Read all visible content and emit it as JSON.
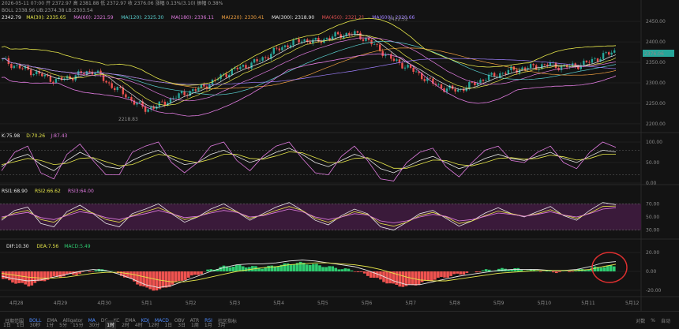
{
  "header": {
    "main_info": "2026-05-11 07:00  开 2372.97  高 2381.88  低 2372.97  收 2376.06  涨幅 0.13%(3.10)  振幅 0.38%",
    "boll": "BOLL  2338.96  UB:2374.38  LB:2303.54",
    "ma_line": [
      {
        "text": "2342.79",
        "color": "#e8e8e8"
      },
      {
        "text": "MA(30): 2335.65",
        "color": "#e6e64a"
      },
      {
        "text": "MA(60): 2321.59",
        "color": "#e07be0"
      },
      {
        "text": "MA(120): 2325.30",
        "color": "#5ad0d0"
      },
      {
        "text": "MA(180): 2336.11",
        "color": "#e07be0"
      },
      {
        "text": "MA(220): 2330.41",
        "color": "#f0a040"
      },
      {
        "text": "MA(300): 2318.90",
        "color": "#e8e8e8"
      },
      {
        "text": "MA(450): 2321.21",
        "color": "#e05050"
      },
      {
        "text": "MA(600): 2320.66",
        "color": "#a080ff"
      }
    ],
    "kdj": [
      {
        "text": "K:75.98",
        "color": "#e8e8e8"
      },
      {
        "text": "D:70.26",
        "color": "#e6e64a"
      },
      {
        "text": "J:87.43",
        "color": "#e07be0"
      }
    ],
    "rsi": [
      {
        "text": "RSI1:68.90",
        "color": "#e8e8e8"
      },
      {
        "text": "RSI2:66.62",
        "color": "#e6e64a"
      },
      {
        "text": "RSI3:64.00",
        "color": "#e07be0"
      }
    ],
    "macd": [
      {
        "text": "DIF:10.30",
        "color": "#e8e8e8"
      },
      {
        "text": "DEA:7.56",
        "color": "#e6e64a"
      },
      {
        "text": "MACD:5.49",
        "color": "#2ecc71"
      }
    ]
  },
  "price_axis": {
    "ticks": [
      "2450.00",
      "2400.00",
      "2350.00",
      "2300.00",
      "2250.00",
      "2200.00"
    ],
    "current": "2376.06",
    "high_label": "2422.52",
    "low_label": "2218.83"
  },
  "kdj_axis": {
    "ticks": [
      "100.00",
      "50.00",
      "0.00"
    ]
  },
  "rsi_axis": {
    "ticks": [
      "70.00",
      "50.00",
      "30.00"
    ]
  },
  "macd_axis": {
    "ticks": [
      "20.00",
      "0.00",
      "-20.00"
    ]
  },
  "x_axis": {
    "labels": [
      "4月28",
      "4月29",
      "4月30",
      "5月1",
      "5月2",
      "5月3",
      "5月4",
      "5月5",
      "5月6",
      "5月7",
      "5月8",
      "5月9",
      "5月10",
      "5月11",
      "5月12"
    ]
  },
  "toolbar": {
    "left": [
      "日期范围",
      "BOLL",
      "EMA",
      "Alligator",
      "MA",
      "DC",
      "KC",
      "",
      "EMA",
      "KDJ",
      "MACD",
      "OBV",
      "ATR",
      "RSI",
      "社区指标"
    ],
    "selected": [
      "BOLL",
      "MA",
      "KDJ",
      "MACD",
      "RSI"
    ],
    "timeframes": [
      "1日",
      "1日",
      "30秒",
      "1分",
      "5分",
      "15分",
      "30分",
      "1时",
      "2时",
      "4时",
      "12时",
      "1日",
      "3日",
      "1周",
      "1月",
      "3月"
    ],
    "active_tf": "1时",
    "right": [
      "对数",
      "%",
      "自动"
    ]
  },
  "colors": {
    "up": "#26a69a",
    "down": "#ef5350",
    "macd_up": "#2ecc71",
    "kdj_band": "#3a1a3a",
    "annotation": "#e03030"
  },
  "chart_data": [
    {
      "type": "candlestick",
      "title": "Price",
      "ylim": [
        2190,
        2460
      ],
      "x_start": "4月28",
      "x_end": "5月12",
      "close_path": [
        2355,
        2340,
        2330,
        2318,
        2305,
        2312,
        2322,
        2330,
        2300,
        2280,
        2255,
        2235,
        2245,
        2262,
        2275,
        2285,
        2300,
        2320,
        2335,
        2345,
        2360,
        2380,
        2395,
        2405,
        2400,
        2410,
        2418,
        2420,
        2405,
        2380,
        2355,
        2340,
        2320,
        2300,
        2285,
        2282,
        2295,
        2310,
        2320,
        2330,
        2335,
        2340,
        2345,
        2338,
        2342,
        2350,
        2365,
        2376.06
      ],
      "high": 2422.52,
      "low": 2218.83,
      "last": 2376.06
    },
    {
      "type": "line",
      "title": "KDJ",
      "ylim": [
        0,
        100
      ],
      "series": [
        {
          "name": "K",
          "values": [
            40,
            60,
            70,
            45,
            30,
            55,
            75,
            60,
            40,
            35,
            55,
            70,
            80,
            60,
            45,
            50,
            70,
            80,
            65,
            50,
            60,
            75,
            85,
            70,
            50,
            40,
            55,
            70,
            60,
            35,
            25,
            40,
            55,
            65,
            50,
            35,
            45,
            60,
            70,
            60,
            55,
            65,
            75,
            60,
            50,
            65,
            80,
            76
          ]
        },
        {
          "name": "D",
          "values": [
            45,
            52,
            60,
            55,
            45,
            48,
            60,
            62,
            52,
            42,
            45,
            58,
            70,
            66,
            55,
            50,
            58,
            70,
            70,
            60,
            58,
            66,
            76,
            74,
            62,
            50,
            50,
            60,
            62,
            50,
            36,
            36,
            46,
            56,
            55,
            45,
            42,
            50,
            60,
            62,
            58,
            60,
            68,
            64,
            56,
            60,
            70,
            70
          ]
        },
        {
          "name": "J",
          "values": [
            30,
            75,
            90,
            25,
            10,
            70,
            95,
            55,
            20,
            20,
            75,
            90,
            100,
            50,
            25,
            50,
            90,
            100,
            55,
            30,
            65,
            90,
            100,
            60,
            25,
            20,
            65,
            90,
            55,
            10,
            5,
            50,
            75,
            85,
            40,
            15,
            50,
            80,
            90,
            55,
            50,
            75,
            90,
            50,
            35,
            75,
            100,
            87
          ]
        }
      ]
    },
    {
      "type": "line",
      "title": "RSI",
      "ylim": [
        20,
        80
      ],
      "series": [
        {
          "name": "RSI1",
          "values": [
            45,
            60,
            65,
            40,
            35,
            58,
            68,
            55,
            40,
            35,
            55,
            62,
            70,
            55,
            42,
            50,
            62,
            70,
            58,
            45,
            55,
            65,
            72,
            60,
            45,
            38,
            52,
            62,
            55,
            35,
            30,
            42,
            55,
            60,
            48,
            36,
            44,
            56,
            64,
            55,
            50,
            58,
            66,
            52,
            45,
            60,
            72,
            68.9
          ]
        },
        {
          "name": "RSI2",
          "values": [
            48,
            56,
            60,
            46,
            42,
            54,
            62,
            56,
            46,
            42,
            52,
            58,
            64,
            56,
            46,
            50,
            58,
            64,
            58,
            48,
            53,
            60,
            66,
            60,
            48,
            42,
            50,
            58,
            54,
            40,
            36,
            42,
            52,
            57,
            50,
            40,
            44,
            52,
            59,
            55,
            51,
            55,
            61,
            53,
            48,
            56,
            66,
            66.62
          ]
        },
        {
          "name": "RSI3",
          "values": [
            50,
            54,
            57,
            49,
            46,
            52,
            58,
            55,
            49,
            46,
            51,
            55,
            60,
            55,
            49,
            51,
            56,
            60,
            57,
            50,
            52,
            57,
            62,
            58,
            50,
            46,
            50,
            55,
            53,
            44,
            41,
            44,
            50,
            54,
            51,
            44,
            46,
            51,
            56,
            54,
            51,
            54,
            58,
            53,
            50,
            55,
            62,
            64
          ]
        }
      ]
    },
    {
      "type": "bar",
      "title": "MACD",
      "ylim": [
        -25,
        25
      ],
      "histogram": [
        -8,
        -12,
        -15,
        -10,
        -6,
        -4,
        -2,
        1,
        2,
        -3,
        -10,
        -18,
        -20,
        -14,
        -8,
        -3,
        2,
        5,
        6,
        5,
        4,
        6,
        8,
        9,
        7,
        5,
        3,
        1,
        -4,
        -9,
        -14,
        -16,
        -13,
        -9,
        -6,
        -3,
        -1,
        1,
        2,
        3,
        2,
        1,
        0,
        -1,
        1,
        3,
        5,
        5.49
      ],
      "series": [
        {
          "name": "DIF",
          "values": [
            -5,
            -8,
            -10,
            -9,
            -6,
            -3,
            0,
            2,
            1,
            -3,
            -8,
            -14,
            -17,
            -15,
            -10,
            -5,
            0,
            4,
            7,
            8,
            8,
            9,
            11,
            12,
            11,
            9,
            7,
            5,
            1,
            -4,
            -10,
            -14,
            -14,
            -11,
            -8,
            -5,
            -3,
            -1,
            1,
            2,
            2,
            2,
            1,
            1,
            2,
            5,
            9,
            10.3
          ]
        },
        {
          "name": "DEA",
          "values": [
            -2,
            -4,
            -6,
            -7,
            -7,
            -6,
            -4,
            -2,
            -1,
            -1,
            -3,
            -6,
            -9,
            -11,
            -11,
            -9,
            -6,
            -3,
            0,
            2,
            4,
            5,
            7,
            8,
            9,
            9,
            8,
            7,
            5,
            2,
            -2,
            -6,
            -9,
            -10,
            -10,
            -8,
            -6,
            -4,
            -2,
            -1,
            0,
            1,
            1,
            1,
            1,
            2,
            5,
            7.56
          ]
        }
      ]
    }
  ]
}
